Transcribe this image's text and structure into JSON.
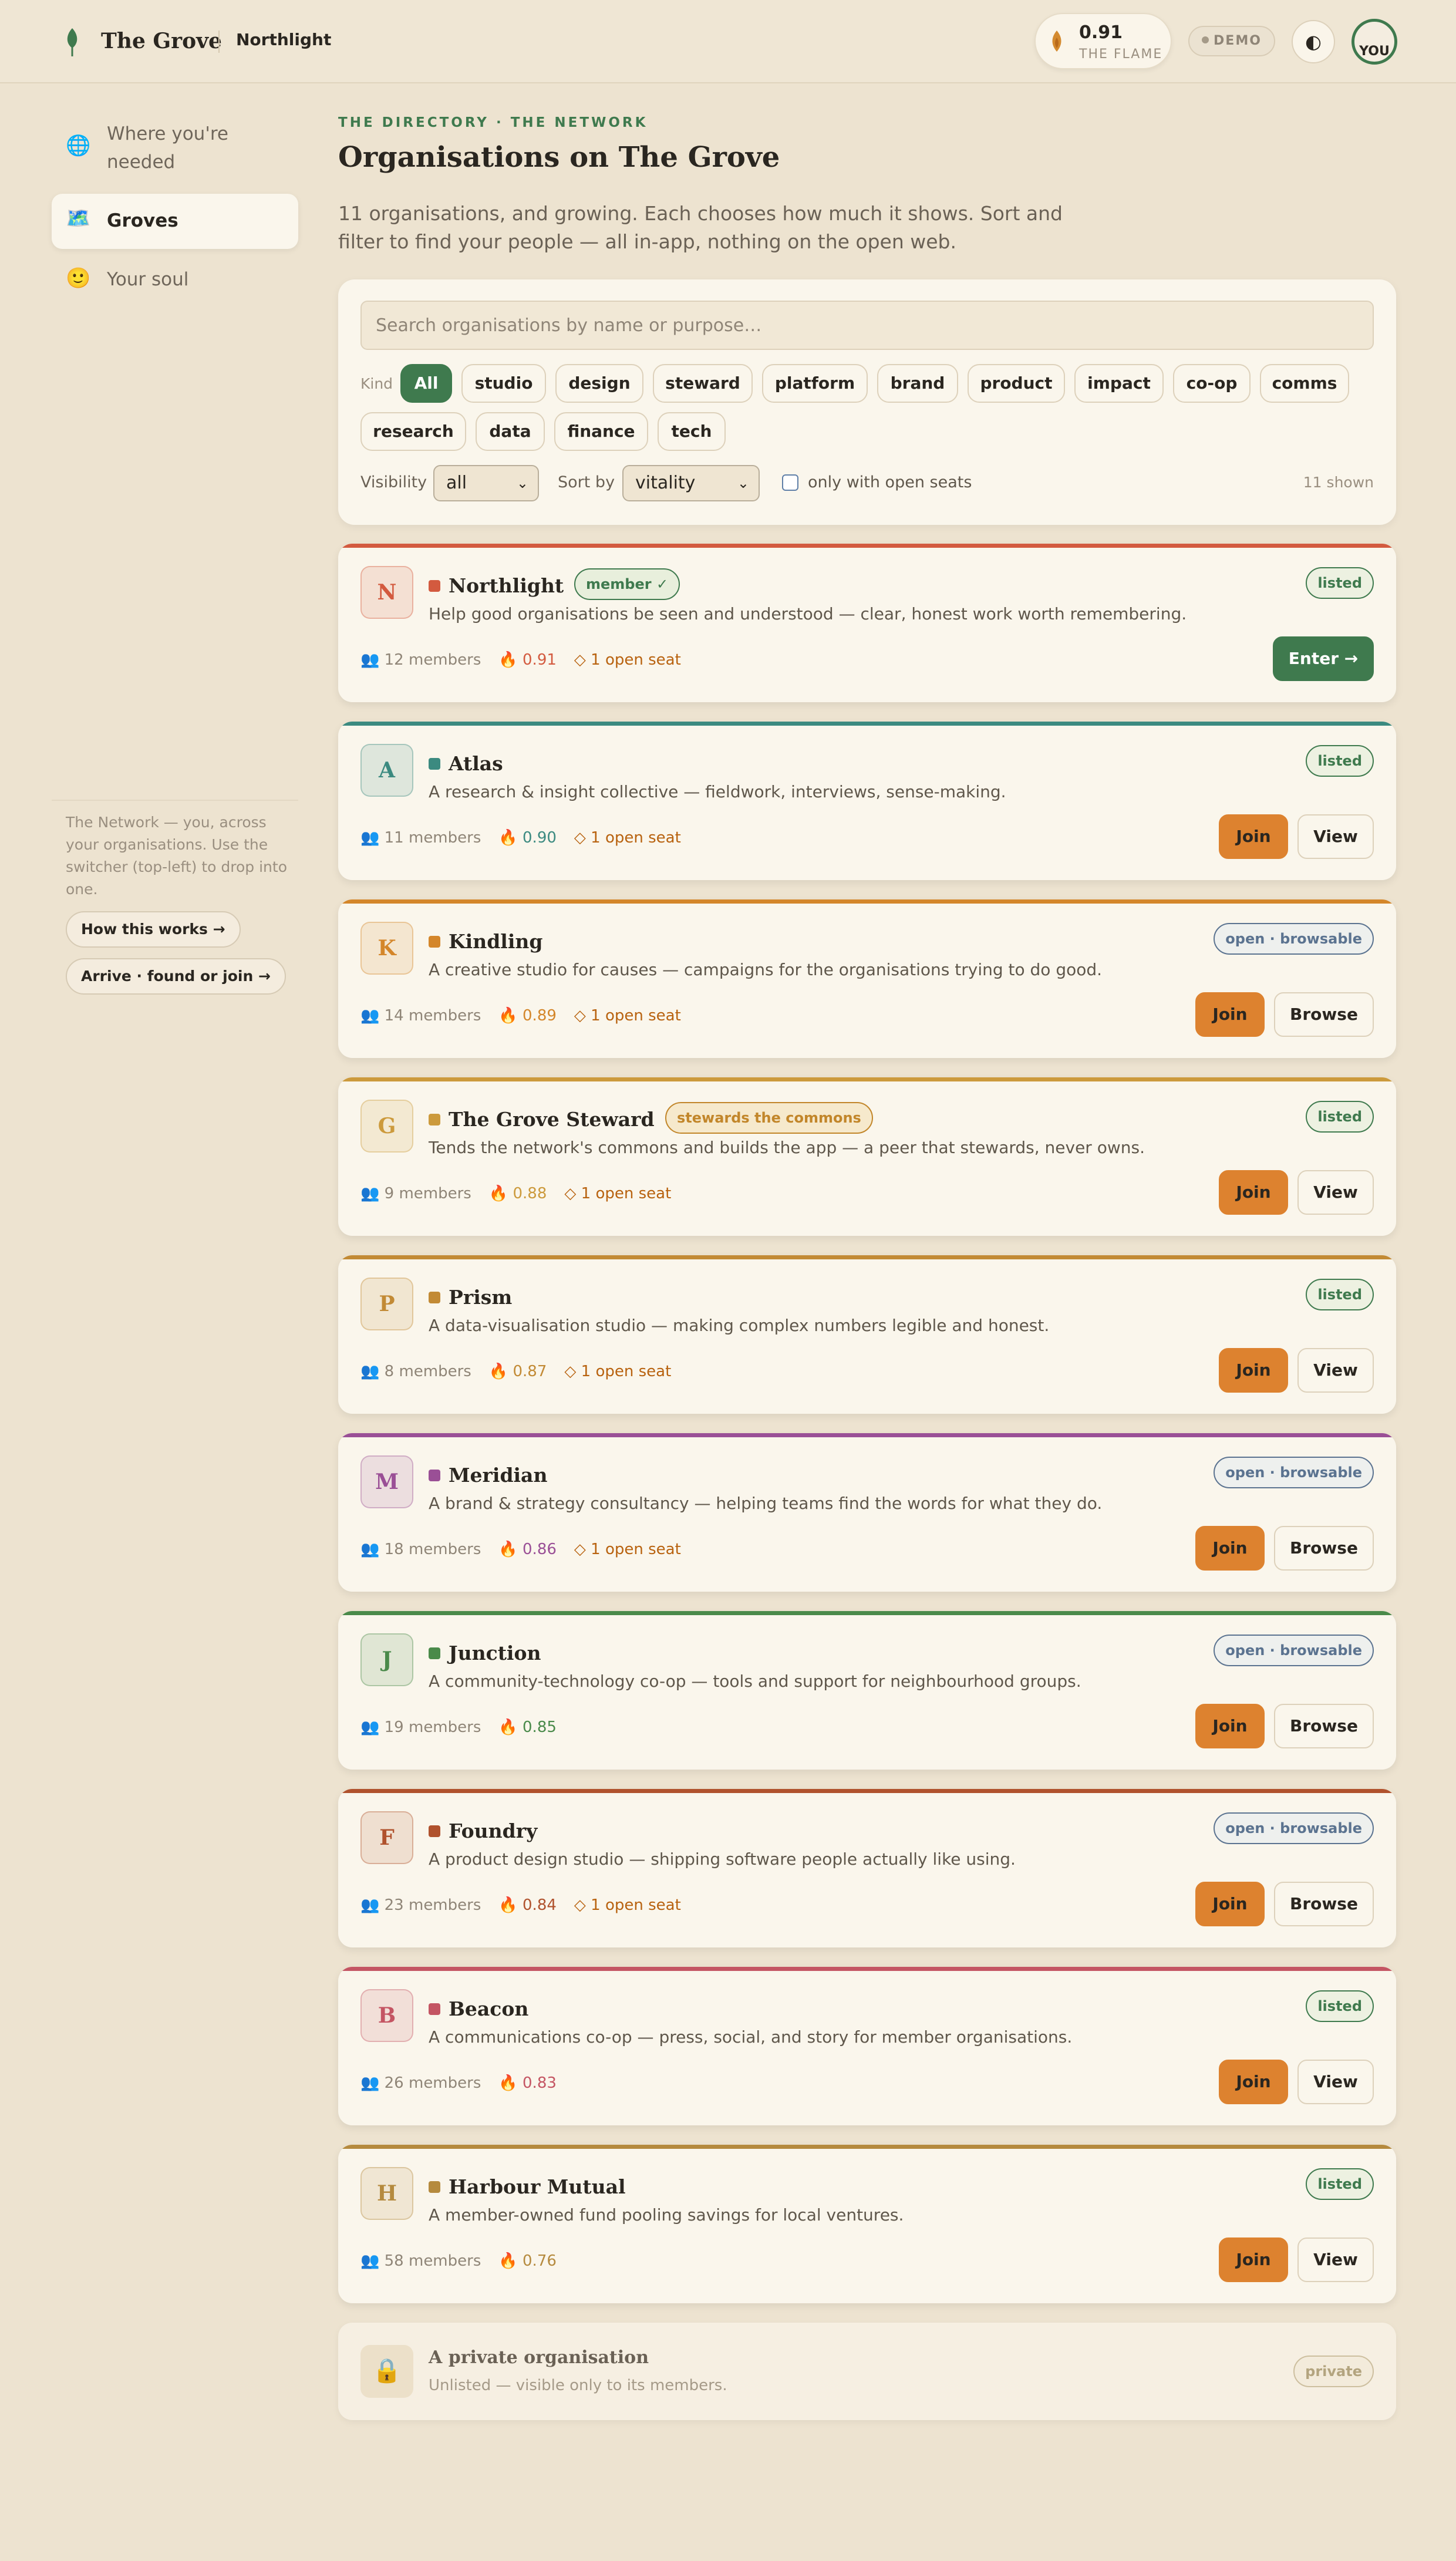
{
  "header": {
    "brand": "The Grove",
    "org": "Northlight",
    "flame_value": "0.91",
    "flame_label": "THE FLAME",
    "demo_label": "DEMO",
    "theme_icon": "◐",
    "avatar_alt": "YOU"
  },
  "sidebar": {
    "items": [
      {
        "icon": "🌐",
        "label": "Where you're needed"
      },
      {
        "icon": "🗺️",
        "label": "Groves"
      },
      {
        "icon": "🙂",
        "label": "Your soul"
      }
    ],
    "note": "The Network — you, across your organisations. Use the switcher (top-left) to drop into one.",
    "how_btn": "How this works →",
    "arrive_btn": "Arrive · found or join →"
  },
  "main": {
    "eyebrow": "THE DIRECTORY · THE NETWORK",
    "title": "Organisations on The Grove",
    "intro": "11 organisations, and growing. Each chooses how much it shows. Sort and filter to find your people — all in-app, nothing on the open web."
  },
  "filters": {
    "search_placeholder": "Search organisations by name or purpose…",
    "kind_label": "Kind",
    "chips": [
      "All",
      "studio",
      "design",
      "steward",
      "platform",
      "brand",
      "product",
      "impact",
      "co-op",
      "comms",
      "research",
      "data",
      "finance",
      "tech"
    ],
    "visibility_label": "Visibility",
    "visibility_value": "all",
    "sort_label": "Sort by",
    "sort_value": "vitality",
    "open_seats_label": "only with open seats",
    "count": "11 shown"
  },
  "orgs": [
    {
      "letter": "N",
      "name": "Northlight",
      "tag": "member ✓",
      "visibility": "listed",
      "desc": "Help good organisations be seen and understood — clear, honest work worth remembering.",
      "members": "👥 12 members",
      "vitality": "🔥 0.91",
      "seats": "◇ 1 open seat",
      "primary": "Enter →",
      "secondary": "",
      "color": "#d35a3f"
    },
    {
      "letter": "A",
      "name": "Atlas",
      "tag": "",
      "visibility": "listed",
      "desc": "A research & insight collective — fieldwork, interviews, sense-making.",
      "members": "👥 11 members",
      "vitality": "🔥 0.90",
      "seats": "◇ 1 open seat",
      "primary": "Join",
      "secondary": "View",
      "color": "#3b8a80"
    },
    {
      "letter": "K",
      "name": "Kindling",
      "tag": "",
      "visibility": "open · browsable",
      "desc": "A creative studio for causes — campaigns for the organisations trying to do good.",
      "members": "👥 14 members",
      "vitality": "🔥 0.89",
      "seats": "◇ 1 open seat",
      "primary": "Join",
      "secondary": "Browse",
      "color": "#d4862a"
    },
    {
      "letter": "G",
      "name": "The Grove Steward",
      "tag": "stewards the commons",
      "visibility": "listed",
      "desc": "Tends the network's commons and builds the app — a peer that stewards, never owns.",
      "members": "👥 9 members",
      "vitality": "🔥 0.88",
      "seats": "◇ 1 open seat",
      "primary": "Join",
      "secondary": "View",
      "color": "#cc9a3c"
    },
    {
      "letter": "P",
      "name": "Prism",
      "tag": "",
      "visibility": "listed",
      "desc": "A data-visualisation studio — making complex numbers legible and honest.",
      "members": "👥 8 members",
      "vitality": "🔥 0.87",
      "seats": "◇ 1 open seat",
      "primary": "Join",
      "secondary": "View",
      "color": "#c28a35"
    },
    {
      "letter": "M",
      "name": "Meridian",
      "tag": "",
      "visibility": "open · browsable",
      "desc": "A brand & strategy consultancy — helping teams find the words for what they do.",
      "members": "👥 18 members",
      "vitality": "🔥 0.86",
      "seats": "◇ 1 open seat",
      "primary": "Join",
      "secondary": "Browse",
      "color": "#9a4f96"
    },
    {
      "letter": "J",
      "name": "Junction",
      "tag": "",
      "visibility": "open · browsable",
      "desc": "A community-technology co-op — tools and support for neighbourhood groups.",
      "members": "👥 19 members",
      "vitality": "🔥 0.85",
      "seats": "",
      "primary": "Join",
      "secondary": "Browse",
      "color": "#4a8a4a"
    },
    {
      "letter": "F",
      "name": "Foundry",
      "tag": "",
      "visibility": "open · browsable",
      "desc": "A product design studio — shipping software people actually like using.",
      "members": "👥 23 members",
      "vitality": "🔥 0.84",
      "seats": "◇ 1 open seat",
      "primary": "Join",
      "secondary": "Browse",
      "color": "#b0522d"
    },
    {
      "letter": "B",
      "name": "Beacon",
      "tag": "",
      "visibility": "listed",
      "desc": "A communications co-op — press, social, and story for member organisations.",
      "members": "👥 26 members",
      "vitality": "🔥 0.83",
      "seats": "",
      "primary": "Join",
      "secondary": "View",
      "color": "#c45563"
    },
    {
      "letter": "H",
      "name": "Harbour Mutual",
      "tag": "",
      "visibility": "listed",
      "desc": "A member-owned fund pooling savings for local ventures.",
      "members": "👥 58 members",
      "vitality": "🔥 0.76",
      "seats": "",
      "primary": "Join",
      "secondary": "View",
      "color": "#b58a3e"
    }
  ],
  "private": {
    "icon": "🔒",
    "title": "A private organisation",
    "desc": "Unlisted — visible only to its members.",
    "tag": "private"
  }
}
